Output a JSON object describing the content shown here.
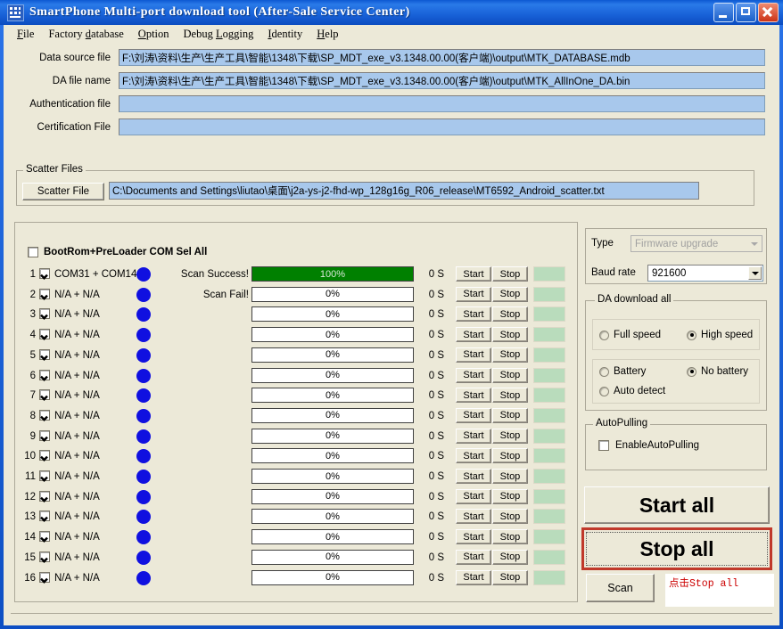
{
  "window": {
    "title": "SmartPhone Multi-port download tool (After-Sale Service Center)",
    "icon": "app-icon",
    "buttons": {
      "minimize": "minimize-icon",
      "maximize": "maximize-icon",
      "close": "close-icon"
    }
  },
  "menubar": {
    "items": [
      {
        "label": "File"
      },
      {
        "label": "Factory database"
      },
      {
        "label": "Option"
      },
      {
        "label": "Debug Logging"
      },
      {
        "label": "Identity"
      },
      {
        "label": "Help"
      }
    ]
  },
  "files": [
    {
      "label": "Data source file",
      "value": "F:\\刘涛\\资料\\生产\\生产工具\\智能\\1348\\下载\\SP_MDT_exe_v3.1348.00.00(客户端)\\output\\MTK_DATABASE.mdb"
    },
    {
      "label": "DA file name",
      "value": "F:\\刘涛\\资料\\生产\\生产工具\\智能\\1348\\下载\\SP_MDT_exe_v3.1348.00.00(客户端)\\output\\MTK_AllInOne_DA.bin"
    },
    {
      "label": "Authentication file",
      "value": ""
    },
    {
      "label": "Certification File",
      "value": ""
    }
  ],
  "scatter": {
    "legend": "Scatter Files",
    "button": "Scatter File",
    "path": "C:\\Documents and Settings\\liutao\\桌面\\j2a-ys-j2-fhd-wp_128g16g_R06_release\\MT6592_Android_scatter.txt"
  },
  "ports": {
    "select_all_label": "BootRom+PreLoader COM Sel All",
    "select_all_checked": false,
    "rows": [
      {
        "index": "1",
        "checked": true,
        "name": "COM31 + COM14",
        "status": "Scan Success!",
        "percent": "100%",
        "fill": 100,
        "time": "0 S",
        "start": "Start",
        "stop": "Stop"
      },
      {
        "index": "2",
        "checked": true,
        "name": "N/A + N/A",
        "status": "Scan Fail!",
        "percent": "0%",
        "fill": 0,
        "time": "0 S",
        "start": "Start",
        "stop": "Stop"
      },
      {
        "index": "3",
        "checked": true,
        "name": "N/A + N/A",
        "status": "",
        "percent": "0%",
        "fill": 0,
        "time": "0 S",
        "start": "Start",
        "stop": "Stop"
      },
      {
        "index": "4",
        "checked": true,
        "name": "N/A + N/A",
        "status": "",
        "percent": "0%",
        "fill": 0,
        "time": "0 S",
        "start": "Start",
        "stop": "Stop"
      },
      {
        "index": "5",
        "checked": true,
        "name": "N/A + N/A",
        "status": "",
        "percent": "0%",
        "fill": 0,
        "time": "0 S",
        "start": "Start",
        "stop": "Stop"
      },
      {
        "index": "6",
        "checked": true,
        "name": "N/A + N/A",
        "status": "",
        "percent": "0%",
        "fill": 0,
        "time": "0 S",
        "start": "Start",
        "stop": "Stop"
      },
      {
        "index": "7",
        "checked": true,
        "name": "N/A + N/A",
        "status": "",
        "percent": "0%",
        "fill": 0,
        "time": "0 S",
        "start": "Start",
        "stop": "Stop"
      },
      {
        "index": "8",
        "checked": true,
        "name": "N/A + N/A",
        "status": "",
        "percent": "0%",
        "fill": 0,
        "time": "0 S",
        "start": "Start",
        "stop": "Stop"
      },
      {
        "index": "9",
        "checked": true,
        "name": "N/A + N/A",
        "status": "",
        "percent": "0%",
        "fill": 0,
        "time": "0 S",
        "start": "Start",
        "stop": "Stop"
      },
      {
        "index": "10",
        "checked": true,
        "name": "N/A + N/A",
        "status": "",
        "percent": "0%",
        "fill": 0,
        "time": "0 S",
        "start": "Start",
        "stop": "Stop"
      },
      {
        "index": "11",
        "checked": true,
        "name": "N/A + N/A",
        "status": "",
        "percent": "0%",
        "fill": 0,
        "time": "0 S",
        "start": "Start",
        "stop": "Stop"
      },
      {
        "index": "12",
        "checked": true,
        "name": "N/A + N/A",
        "status": "",
        "percent": "0%",
        "fill": 0,
        "time": "0 S",
        "start": "Start",
        "stop": "Stop"
      },
      {
        "index": "13",
        "checked": true,
        "name": "N/A + N/A",
        "status": "",
        "percent": "0%",
        "fill": 0,
        "time": "0 S",
        "start": "Start",
        "stop": "Stop"
      },
      {
        "index": "14",
        "checked": true,
        "name": "N/A + N/A",
        "status": "",
        "percent": "0%",
        "fill": 0,
        "time": "0 S",
        "start": "Start",
        "stop": "Stop"
      },
      {
        "index": "15",
        "checked": true,
        "name": "N/A + N/A",
        "status": "",
        "percent": "0%",
        "fill": 0,
        "time": "0 S",
        "start": "Start",
        "stop": "Stop"
      },
      {
        "index": "16",
        "checked": true,
        "name": "N/A + N/A",
        "status": "",
        "percent": "0%",
        "fill": 0,
        "time": "0 S",
        "start": "Start",
        "stop": "Stop"
      }
    ]
  },
  "settings": {
    "type_label": "Type",
    "type_value": "Firmware upgrade",
    "type_disabled": true,
    "baud_label": "Baud rate",
    "baud_value": "921600",
    "da_group_legend": "DA download all",
    "speed_options": [
      {
        "label": "Full speed",
        "selected": false
      },
      {
        "label": "High speed",
        "selected": true
      }
    ],
    "battery_options": [
      {
        "label": "Battery",
        "selected": false
      },
      {
        "label": "No battery",
        "selected": true
      },
      {
        "label": "Auto detect",
        "selected": false
      }
    ],
    "autopulling_legend": "AutoPulling",
    "autopulling_label": "EnableAutoPulling",
    "autopulling_checked": false
  },
  "actions": {
    "start_all": "Start all",
    "stop_all": "Stop all",
    "scan": "Scan",
    "note": "点击Stop all"
  },
  "colors": {
    "titlebar": "#1a64da",
    "client_bg": "#ece9d8",
    "field_bg": "#a8c8ec",
    "progress_green": "#008000",
    "led_green": "#b9dcbc",
    "highlight_red": "#c0392b",
    "note_red": "#cc0000",
    "dot_blue": "#1010e0"
  }
}
